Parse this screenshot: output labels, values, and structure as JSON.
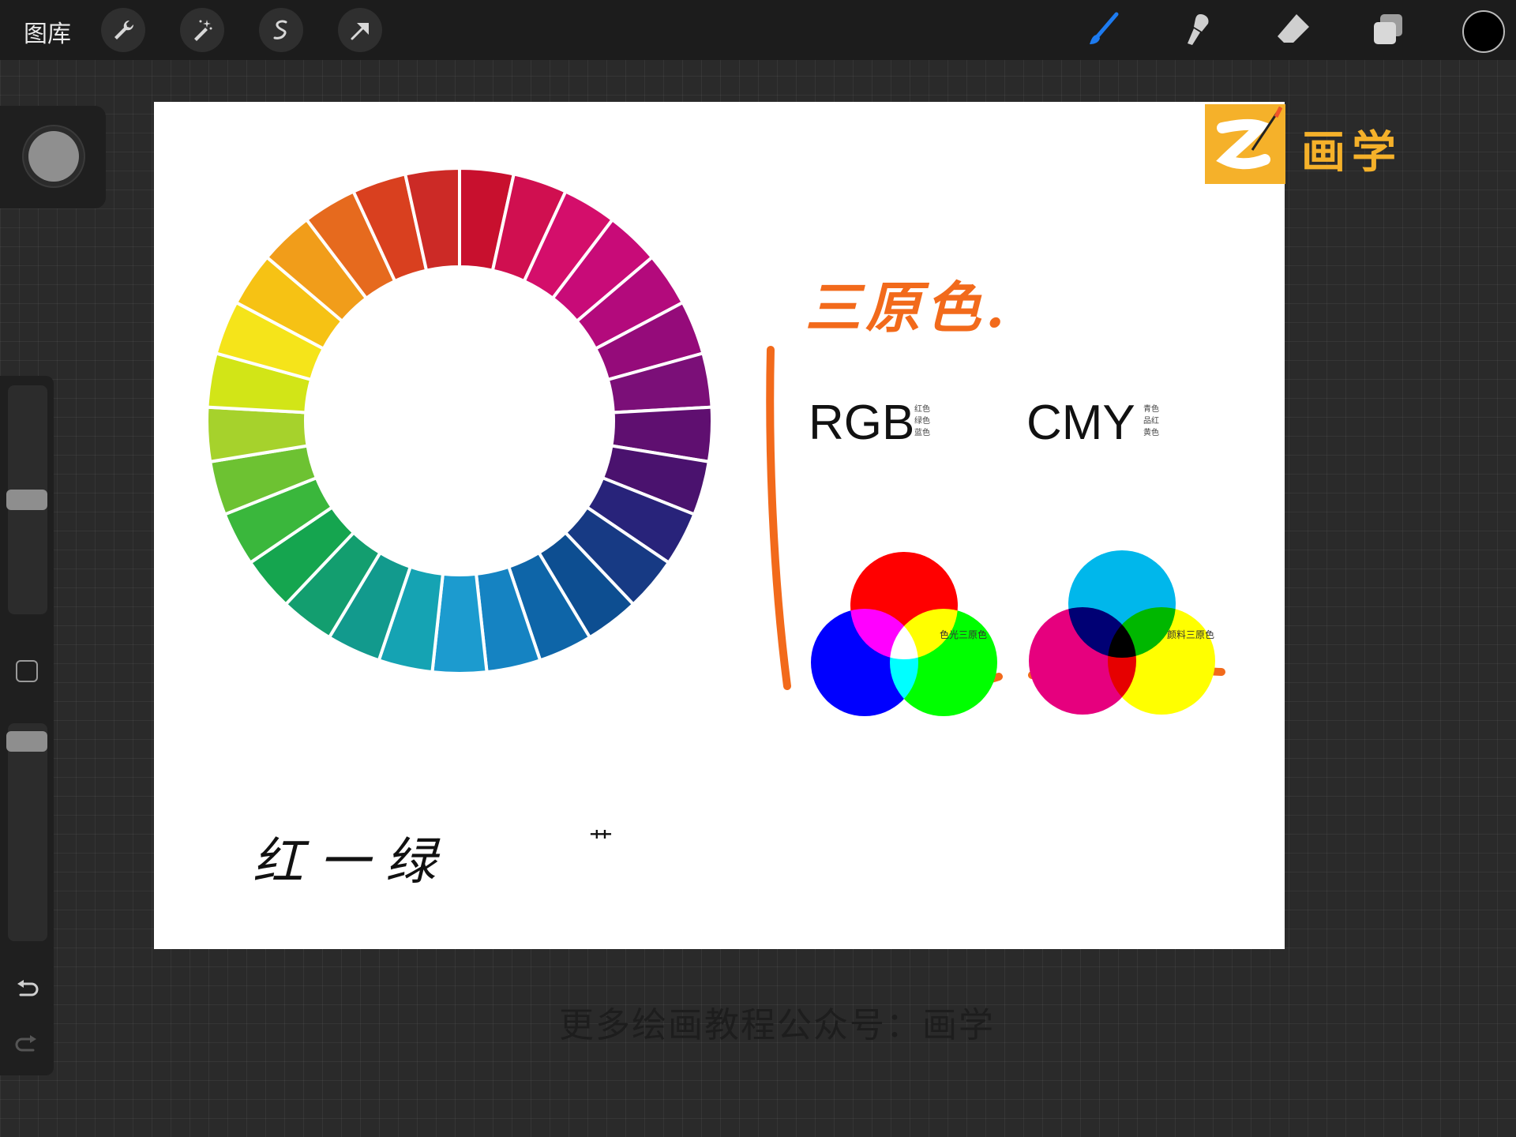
{
  "topbar": {
    "gallery_label": "图库",
    "tools_left": [
      "wrench-icon",
      "magic-wand-icon",
      "selection-icon",
      "transform-arrow-icon"
    ],
    "tools_right": [
      "brush-icon",
      "smudge-icon",
      "eraser-icon",
      "layers-icon"
    ],
    "active_tool": "brush-icon",
    "active_color": "#000000"
  },
  "sidebar": {
    "undo_icon": "undo-icon",
    "redo_icon": "redo-icon"
  },
  "canvas": {
    "logo_text": "画学",
    "title_handwritten": "三原色.",
    "rgb": {
      "label": "RGB",
      "notes": [
        "红色",
        "绿色",
        "蓝色"
      ],
      "caption": "色光三原色",
      "colors": [
        "#ff0000",
        "#00ff00",
        "#0000ff"
      ]
    },
    "cmy": {
      "label": "CMY",
      "notes": [
        "青色",
        "品红",
        "黄色"
      ],
      "caption": "颜料三原色",
      "colors": [
        "#00b7eb",
        "#e6007e",
        "#ffff00"
      ]
    },
    "color_wheel": {
      "segments": [
        "#c8102e",
        "#d00f50",
        "#d40e6b",
        "#c80b78",
        "#b30a7c",
        "#950b7a",
        "#7b0f78",
        "#5f0f70",
        "#4a126e",
        "#28237a",
        "#173a84",
        "#0d4e91",
        "#0e65a8",
        "#1583c2",
        "#1c9bcf",
        "#15a3b3",
        "#129a8d",
        "#139e6f",
        "#15a54f",
        "#3ab73c",
        "#6dc232",
        "#a6d22c",
        "#d2e517",
        "#f5e41a",
        "#f6c214",
        "#f19d1a",
        "#e66a1e",
        "#d9401f",
        "#cc2a26"
      ]
    },
    "handwritten_bottom": "红一绿",
    "handwritten_mark": "艹"
  },
  "watermark": "更多绘画教程公众号：画学"
}
